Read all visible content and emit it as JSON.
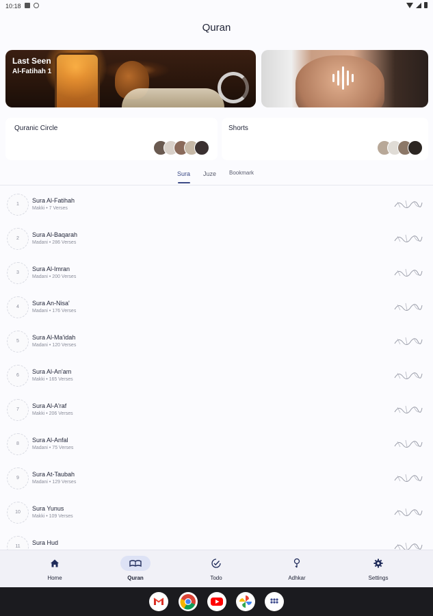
{
  "status_bar": {
    "time": "10:18"
  },
  "app": {
    "title": "Quran"
  },
  "last_seen": {
    "heading": "Last Seen",
    "sura": "Al-Fatihah 1"
  },
  "cards": [
    {
      "label": "Quranic Circle"
    },
    {
      "label": "Shorts"
    }
  ],
  "tabs": [
    {
      "label": "Sura",
      "active": true
    },
    {
      "label": "Juze",
      "active": false
    },
    {
      "label": "Bookmark",
      "active": false
    }
  ],
  "suras": [
    {
      "number": "1",
      "name": "Sura Al-Fatihah",
      "meta": "Makki • 7 Verses"
    },
    {
      "number": "2",
      "name": "Sura Al-Baqarah",
      "meta": "Madani • 286 Verses"
    },
    {
      "number": "3",
      "name": "Sura Al-Imran",
      "meta": "Madani • 200 Verses"
    },
    {
      "number": "4",
      "name": "Sura An-Nisa'",
      "meta": "Madani • 176 Verses"
    },
    {
      "number": "5",
      "name": "Sura Al-Ma'idah",
      "meta": "Madani • 120 Verses"
    },
    {
      "number": "6",
      "name": "Sura Al-An'am",
      "meta": "Makki • 165 Verses"
    },
    {
      "number": "7",
      "name": "Sura Al-A'raf",
      "meta": "Makki • 206 Verses"
    },
    {
      "number": "8",
      "name": "Sura Al-Anfal",
      "meta": "Madani • 75 Verses"
    },
    {
      "number": "9",
      "name": "Sura At-Taubah",
      "meta": "Madani • 129 Verses"
    },
    {
      "number": "10",
      "name": "Sura Yunus",
      "meta": "Makki • 109 Verses"
    },
    {
      "number": "11",
      "name": "Sura Hud",
      "meta": ""
    }
  ],
  "nav": {
    "items": [
      {
        "label": "Home",
        "icon": "home-icon"
      },
      {
        "label": "Quran",
        "icon": "quran-icon",
        "active": true
      },
      {
        "label": "Todo",
        "icon": "todo-icon"
      },
      {
        "label": "Adhkar",
        "icon": "adhkar-icon"
      },
      {
        "label": "Settings",
        "icon": "settings-icon"
      }
    ]
  },
  "taskbar_apps": [
    "gmail-icon",
    "chrome-icon",
    "youtube-icon",
    "photos-icon",
    "app-drawer-icon"
  ],
  "colors": {
    "accent": "#3b4a86",
    "nav_active_bg": "#dde2f5"
  }
}
